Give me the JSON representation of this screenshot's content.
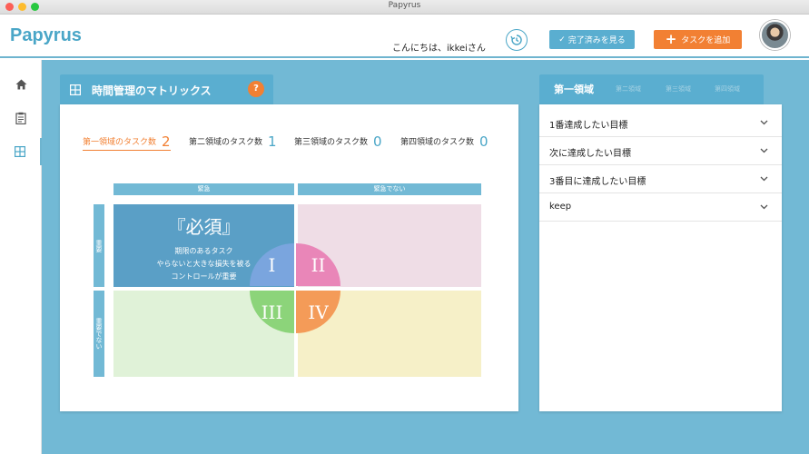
{
  "window": {
    "title": "Papyrus"
  },
  "header": {
    "logo": "Papyrus",
    "greeting": "こんにちは、ikkeiさん",
    "done_button": "完了済みを見る",
    "add_button": "タスクを追加"
  },
  "sidebar": {
    "items": [
      {
        "icon": "home-icon"
      },
      {
        "icon": "clipboard-icon"
      },
      {
        "icon": "grid-icon",
        "active": true
      }
    ]
  },
  "matrix": {
    "title": "時間管理のマトリックス",
    "help": "?",
    "counts": [
      {
        "label": "第一領域のタスク数",
        "value": "2",
        "active": true
      },
      {
        "label": "第二領域のタスク数",
        "value": "1"
      },
      {
        "label": "第三領域のタスク数",
        "value": "0"
      },
      {
        "label": "第四領域のタスク数",
        "value": "0"
      }
    ],
    "col_headers": [
      "緊急",
      "緊急でない"
    ],
    "row_headers": [
      "重要",
      "重要でない"
    ],
    "must_title": "『必須』",
    "must_desc": [
      "期限のあるタスク",
      "やらないと大きな損失を被る",
      "コントロールが重要"
    ],
    "numerals": [
      "I",
      "II",
      "III",
      "IV"
    ],
    "colors": {
      "q1": "#5a9fc6",
      "q2": "#efdde6",
      "q3": "#e0f2d8",
      "q4": "#f6f0c8"
    }
  },
  "goals": {
    "tabs": [
      "第一領域",
      "第二領域",
      "第三領域",
      "第四領域"
    ],
    "items": [
      "1番達成したい目標",
      "次に達成したい目標",
      "3番目に達成したい目標",
      "keep"
    ]
  },
  "accent": "#4aa6c7",
  "orange": "#f28033"
}
